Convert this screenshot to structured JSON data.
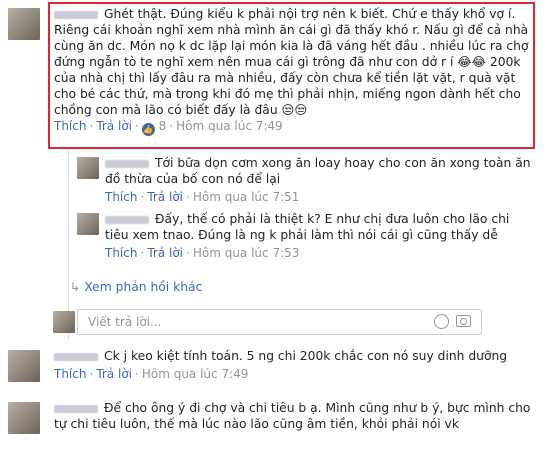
{
  "comments": [
    {
      "text": "Ghét thật. Đúng kiểu k phải nội trợ nên k biết. Chứ e thấy khổ vợ í. Riêng cái khoản nghĩ xem nhà mình ăn cái gì đã thấy khó r. Nấu gì để cả nhà cùng ăn dc. Món nọ k dc lặp lại món kia là đã váng hết đầu . nhiều lúc ra chợ đứng ngẫn tò te nghĩ xem nên mua cái gì trông đã như con dở r í 😂😂 200k của nhà chị thì lấy đâu ra mà nhiều, đấy còn chưa kể tiền lặt vặt, r quà vặt cho bé các thứ, mà trong khi đó mẹ thì phải nhịn, miếng ngon dành hết cho chồng con mà lão có biết đấy là đâu 😒😒",
      "like": "Thích",
      "reply": "Trả lời",
      "reactions": "8",
      "time": "Hôm qua lúc 7:49"
    },
    {
      "text": "Tới bữa dọn cơm xong ăn loay hoay cho con ăn xong toàn ăn đồ thừa của bố con nó để lại",
      "like": "Thích",
      "reply": "Trả lời",
      "time": "Hôm qua lúc 7:51"
    },
    {
      "text": "Đấy, thế có phải là thiệt k? E như chị đưa luôn cho lão chi tiêu xem tnao. Đúng là ng k phải làm thì nói cái gì cũng thấy dễ",
      "like": "Thích",
      "reply": "Trả lời",
      "time": "Hôm qua lúc 7:53"
    },
    {
      "text": "Ck j keo kiệt tính toán. 5 ng chi 200k chắc con nó suy dinh dưỡng",
      "like": "Thích",
      "reply": "Trả lời",
      "time": "Hôm qua lúc 7:49"
    },
    {
      "text": "Để cho ông ý đi chợ và chi tiêu b ạ. Mình cũng như b ý, bực mình cho tự chi tiêu luôn, thế mà lúc nào lão cũng âm tiền, khỏi phải nói vk",
      "like": "Thích",
      "reply": "Trả lời",
      "time": "Hôm qua lúc 7:53"
    }
  ],
  "more_replies": "Xem phản hồi khác",
  "reply_placeholder": "Viết trả lời..."
}
